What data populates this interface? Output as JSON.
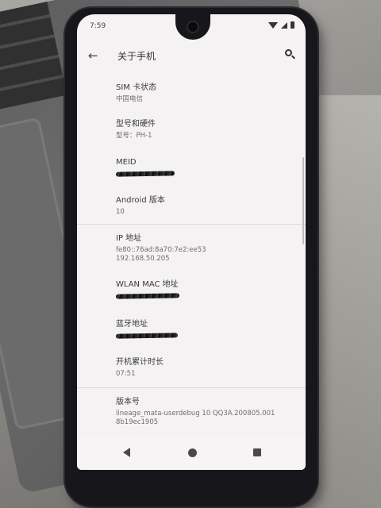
{
  "status_bar": {
    "time": "7:59"
  },
  "app_bar": {
    "back": "←",
    "title": "关于手机"
  },
  "items": [
    {
      "label": "SIM 卡状态",
      "value": "中国电信"
    },
    {
      "label": "型号和硬件",
      "value": "型号：PH-1"
    },
    {
      "label": "MEID",
      "value": ""
    },
    {
      "label": "Android 版本",
      "value": "10"
    },
    {
      "label": "IP 地址",
      "value": "fe80::76ad:8a70:7e2:ee53",
      "value2": "192.168.50.205"
    },
    {
      "label": "WLAN MAC 地址",
      "value": ""
    },
    {
      "label": "蓝牙地址",
      "value": ""
    },
    {
      "label": "开机累计时长",
      "value": "07:51"
    },
    {
      "label": "版本号",
      "value": "lineage_mata-userdebug 10 QQ3A.200805.001",
      "value2": "8b19ec1905"
    }
  ]
}
